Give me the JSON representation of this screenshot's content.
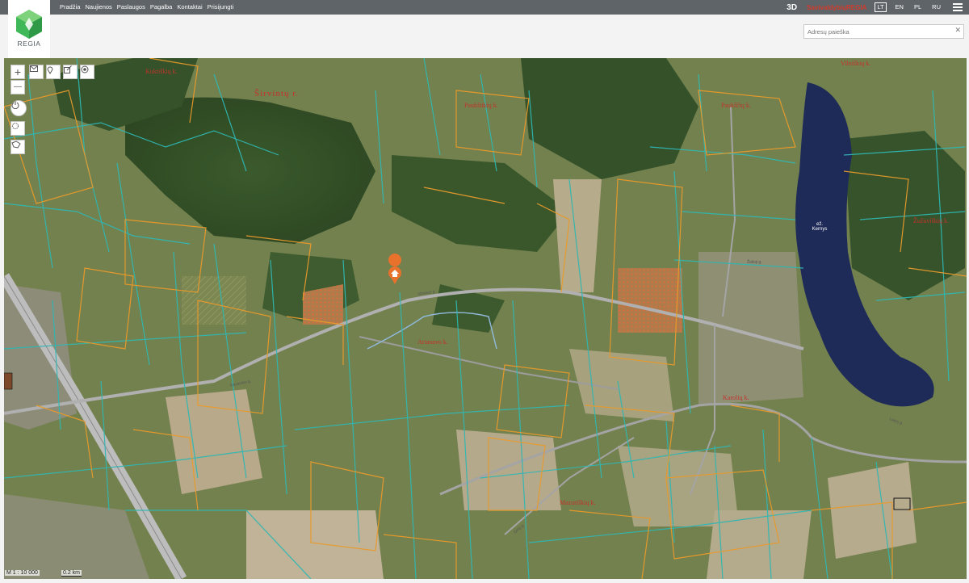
{
  "topnav": {
    "items": [
      "Pradžia",
      "Naujienos",
      "Paslaugos",
      "Pagalba",
      "Kontaktai",
      "Prisijungti"
    ]
  },
  "toolbar": {
    "btn_3d": "3D",
    "brand_prefix": "Savivaldybių",
    "brand_name": "REGIA",
    "languages": [
      "LT",
      "EN",
      "PL",
      "RU"
    ],
    "active_language": "LT",
    "menu_icon": "hamburger-icon"
  },
  "logo": {
    "text": "REGIA",
    "icon": "regia-gem-logo"
  },
  "search": {
    "placeholder": "Adresų paieška",
    "value": "",
    "clear_icon": "close-icon"
  },
  "map_controls": {
    "zoom_in": "+",
    "zoom_out": "—",
    "icons": [
      "zoom-in-icon",
      "zoom-out-icon",
      "envelope-icon",
      "pin-icon",
      "edit-icon",
      "target-icon",
      "power-icon",
      "locate-icon",
      "lasso-icon"
    ]
  },
  "map": {
    "labels": {
      "sirvintu": "Širvintų r.",
      "kuktiskiu": "Kuktiškių k.",
      "paukstikiu": "Paukštikių k.",
      "pauksciu": "Paukščių k.",
      "vilniskiu": "Vilniškių k.",
      "zuzuviskiu": "Žužuviškių k.",
      "artanavo": "Artanavo k.",
      "karoliu": "Karolių k.",
      "mazurisku": "Mazuriškių k."
    },
    "lake_symbol": "ež.",
    "lake_name": "Kernys",
    "roads": [
      "Vilniaus g.",
      "Kavarsko g.",
      "Girių g.",
      "Žalioji g.",
      "Liepų g."
    ],
    "marker_icon": "home-marker-icon",
    "colors": {
      "parcel_teal": "#2fb7b3",
      "parcel_orange": "#e99a2b",
      "lake": "#1e2a58",
      "label_red": "#c3332b",
      "road": "#8a8a8a"
    }
  },
  "scale": {
    "ratio": "M 1 : 10 000",
    "bar": "0.2 km"
  }
}
